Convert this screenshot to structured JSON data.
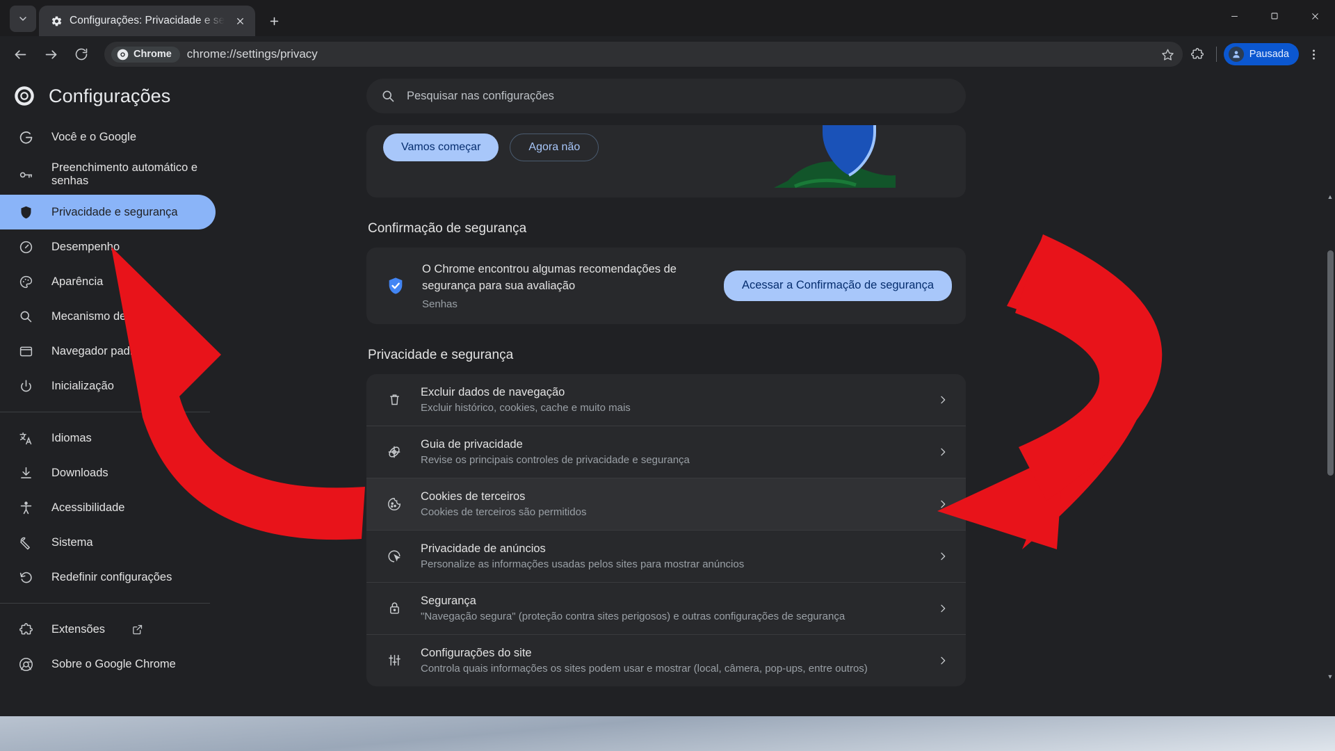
{
  "window": {
    "tab": {
      "title": "Configurações: Privacidade e se",
      "favicon": "gear-icon",
      "close": "×"
    },
    "tab_search_icon": "chevron-down-icon",
    "new_tab_icon": "plus-icon",
    "controls": {
      "minimize": "—",
      "maximize": "▢",
      "close": "✕"
    }
  },
  "toolbar": {
    "back_icon": "arrow-left-icon",
    "forward_icon": "arrow-right-icon",
    "reload_icon": "reload-icon",
    "chip_label": "Chrome",
    "chip_icon": "chrome-icon",
    "url": "chrome://settings/privacy",
    "star_icon": "star-icon",
    "extensions_icon": "puzzle-icon",
    "menu_icon": "kebab-menu-icon",
    "profile_label": "Pausada",
    "profile_icon": "avatar-icon"
  },
  "settings": {
    "brand_icon": "chrome-logo-icon",
    "title": "Configurações",
    "search": {
      "placeholder": "Pesquisar nas configurações",
      "icon": "search-icon",
      "value": ""
    }
  },
  "sidebar": {
    "items": [
      {
        "label": "Você e o Google",
        "icon": "google-g-icon",
        "active": false
      },
      {
        "label": "Preenchimento automático e senhas",
        "icon": "key-icon",
        "active": false,
        "two_line": true
      },
      {
        "label": "Privacidade e segurança",
        "icon": "shield-icon",
        "active": true
      },
      {
        "label": "Desempenho",
        "icon": "speedometer-icon",
        "active": false
      },
      {
        "label": "Aparência",
        "icon": "palette-icon",
        "active": false
      },
      {
        "label": "Mecanismo de pesquisa",
        "icon": "search-icon",
        "active": false
      },
      {
        "label": "Navegador padrão",
        "icon": "browser-window-icon",
        "active": false
      },
      {
        "label": "Inicialização",
        "icon": "power-icon",
        "active": false
      }
    ],
    "items2": [
      {
        "label": "Idiomas",
        "icon": "translate-icon"
      },
      {
        "label": "Downloads",
        "icon": "download-icon"
      },
      {
        "label": "Acessibilidade",
        "icon": "accessibility-icon"
      },
      {
        "label": "Sistema",
        "icon": "wrench-icon"
      },
      {
        "label": "Redefinir configurações",
        "icon": "restore-icon"
      }
    ],
    "items3": [
      {
        "label": "Extensões",
        "icon": "puzzle-icon",
        "external": true
      },
      {
        "label": "Sobre o Google Chrome",
        "icon": "chrome-logo-icon",
        "external": false
      }
    ]
  },
  "main": {
    "promo": {
      "primary_button": "Vamos começar",
      "secondary_button": "Agora não",
      "art_icon": "shield-landscape-illustration"
    },
    "safety_section_title": "Confirmação de segurança",
    "safety": {
      "icon": "shield-check-icon",
      "title": "O Chrome encontrou algumas recomendações de segurança para sua avaliação",
      "subtitle": "Senhas",
      "button": "Acessar a Confirmação de segurança"
    },
    "privacy_section_title": "Privacidade e segurança",
    "privacy_items": [
      {
        "icon": "trash-icon",
        "title": "Excluir dados de navegação",
        "subtitle": "Excluir histórico, cookies, cache e muito mais",
        "hovered": false
      },
      {
        "icon": "privacy-guide-icon",
        "title": "Guia de privacidade",
        "subtitle": "Revise os principais controles de privacidade e segurança",
        "hovered": false
      },
      {
        "icon": "cookie-icon",
        "title": "Cookies de terceiros",
        "subtitle": "Cookies de terceiros são permitidos",
        "hovered": true
      },
      {
        "icon": "ad-privacy-icon",
        "title": "Privacidade de anúncios",
        "subtitle": "Personalize as informações usadas pelos sites para mostrar anúncios",
        "hovered": false
      },
      {
        "icon": "lock-icon",
        "title": "Segurança",
        "subtitle": "\"Navegação segura\" (proteção contra sites perigosos) e outras configurações de segurança",
        "hovered": false
      },
      {
        "icon": "sliders-icon",
        "title": "Configurações do site",
        "subtitle": "Controla quais informações os sites podem usar e mostrar (local, câmera, pop-ups, entre outros)",
        "hovered": false
      }
    ],
    "row_arrow_icon": "chevron-right-icon"
  },
  "annotations": {
    "arrow_color": "#e8131a",
    "arrow_left_target": "Privacidade e segurança",
    "arrow_right_target": "Cookies de terceiros"
  },
  "colors": {
    "accent_blue": "#8ab4f8",
    "button_blue": "#a8c7fa",
    "profile_blue": "#0b57d0",
    "bg": "#202124",
    "card_bg": "#28292c",
    "text": "#e3e3e3",
    "muted": "#9aa0a6"
  }
}
